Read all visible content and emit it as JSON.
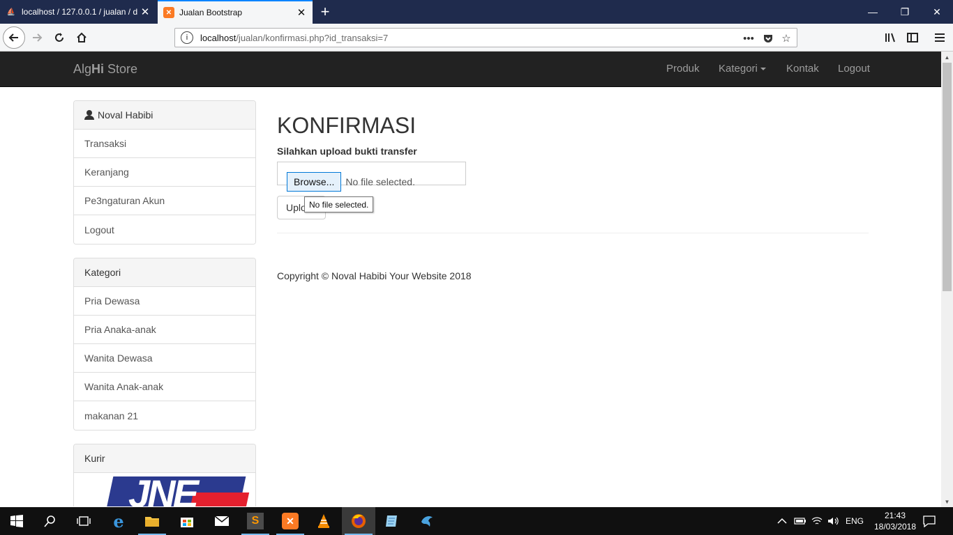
{
  "browser": {
    "tabs": [
      {
        "title": "localhost / 127.0.0.1 / jualan / d",
        "active": false
      },
      {
        "title": "Jualan Bootstrap",
        "active": true
      }
    ],
    "url_host": "localhost",
    "url_path": "/jualan/konfirmasi.php?id_transaksi=7",
    "new_tab_label": "+",
    "more_label": "•••"
  },
  "site": {
    "brand_prefix": "Alg",
    "brand_bold": "Hi",
    "brand_suffix": " Store",
    "nav": {
      "produk": "Produk",
      "kategori": "Kategori",
      "kontak": "Kontak",
      "logout": "Logout"
    }
  },
  "sidebar": {
    "user": {
      "name": "Noval Habibi",
      "items": [
        "Transaksi",
        "Keranjang",
        "Pe3ngaturan Akun",
        "Logout"
      ]
    },
    "kategori": {
      "title": "Kategori",
      "items": [
        "Pria Dewasa",
        "Pria Anaka-anak",
        "Wanita Dewasa",
        "Wanita Anak-anak",
        "makanan 21"
      ]
    },
    "kurir": {
      "title": "Kurir",
      "logo_text": "JNE"
    }
  },
  "main": {
    "title": "KONFIRMASI",
    "upload_label": "Silahkan upload bukti transfer",
    "browse_label": "Browse...",
    "file_status": "No file selected.",
    "upload_button": "Upload",
    "tooltip": "No file selected.",
    "footer": "Copyright © Noval Habibi Your Website 2018"
  },
  "taskbar": {
    "language": "ENG",
    "time": "21:43",
    "date": "18/03/2018"
  },
  "colors": {
    "navbar_bg": "#222222",
    "titlebar_bg": "#1f2b4d",
    "accent": "#0a84ff"
  }
}
